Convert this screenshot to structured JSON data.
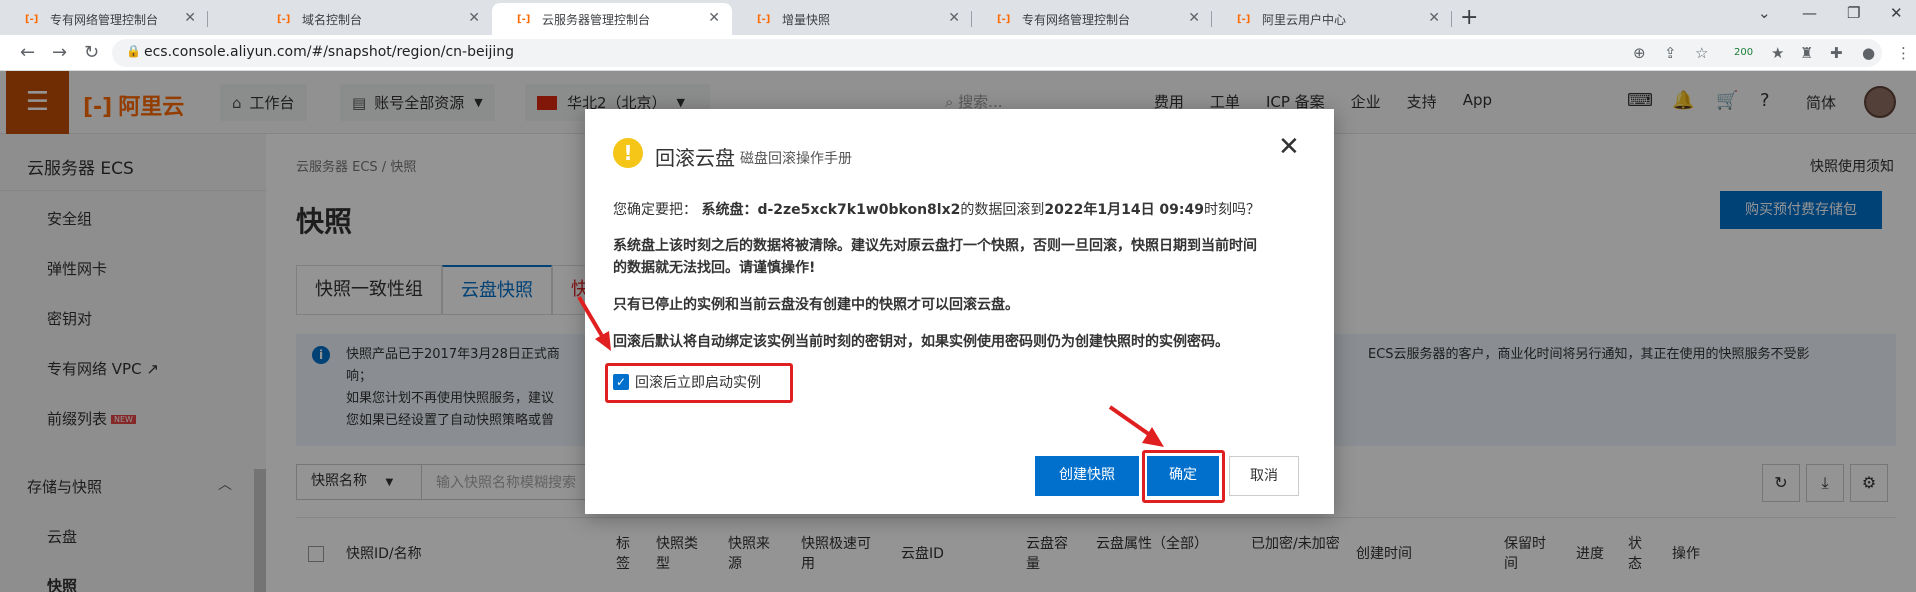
{
  "browser": {
    "tabs": [
      {
        "title": "专有网络管理控制台",
        "active": false
      },
      {
        "title": "域名控制台",
        "active": false
      },
      {
        "title": "云服务器管理控制台",
        "active": true
      },
      {
        "title": "增量快照",
        "active": false
      },
      {
        "title": "专有网络管理控制台",
        "active": false
      },
      {
        "title": "阿里云用户中心",
        "active": false
      }
    ],
    "new_tab": "+",
    "url": "ecs.console.aliyun.com/#/snapshot/region/cn-beijing",
    "ext_badge": "200"
  },
  "topbar": {
    "logo": "阿里云",
    "workbench": "工作台",
    "resources": "账号全部资源",
    "region": "华北2（北京）",
    "search_placeholder": "搜索...",
    "links": [
      "费用",
      "工单",
      "ICP 备案",
      "企业",
      "支持",
      "App"
    ],
    "lang": "简体"
  },
  "sidebar": {
    "title": "云服务器 ECS",
    "items": [
      "安全组",
      "弹性网卡",
      "密钥对",
      "专有网络 VPC",
      "前缀列表"
    ],
    "new_badge": "NEW",
    "group": "存储与快照",
    "sub_items": [
      "云盘",
      "快照"
    ]
  },
  "main": {
    "breadcrumb": "云服务器 ECS  /  快照",
    "page_title": "快照",
    "help_link": "快照使用须知",
    "buy_button": "购买预付费存储包",
    "tabs": [
      "快照一致性组",
      "云盘快照",
      "快"
    ],
    "notice_lines": [
      "快照产品已于2017年3月28日正式商",
      "响；",
      "如果您计划不再使用快照服务，建议",
      "您如果已经设置了自动快照策略或曾"
    ],
    "notice_right": "ECS云服务器的客户，商业化时间将另行通知，其正在使用的快照服务不受影",
    "filter_select": "快照名称",
    "filter_placeholder": "输入快照名称模糊搜索",
    "table_headers": [
      "快照ID/名称",
      "标签",
      "快照类型",
      "快照来源",
      "快照极速可用",
      "云盘ID",
      "云盘容量",
      "云盘属性（全部）",
      "已加密/未加密",
      "创建时间",
      "保留时间",
      "进度",
      "状态",
      "操作"
    ]
  },
  "dialog": {
    "title": "回滚云盘",
    "manual_link": "磁盘回滚操作手册",
    "line1_prefix": "您确定要把：",
    "line1_disk_label": "系统盘：",
    "line1_disk_id": "d-2ze5xck7k1w0bkon8lx2",
    "line1_mid": "的数据回滚到",
    "line1_time": "2022年1月14日 09:49",
    "line1_suffix": "时刻吗？",
    "line2": "系统盘上该时刻之后的数据将被清除。建议先对原云盘打一个快照，否则一旦回滚，快照日期到当前时间",
    "line2b": "的数据就无法找回。请谨慎操作!",
    "line3": "只有已停止的实例和当前云盘没有创建中的快照才可以回滚云盘。",
    "line4": "回滚后默认将自动绑定该实例当前时刻的密钥对，如果实例使用密码则仍为创建快照时的实例密码。",
    "checkbox_label": "回滚后立即启动实例",
    "checkbox_checked": true,
    "btn_create": "创建快照",
    "btn_ok": "确定",
    "btn_cancel": "取消"
  },
  "colors": {
    "brand": "#ff6a00",
    "primary": "#0070cc",
    "annotation": "#e02020"
  }
}
